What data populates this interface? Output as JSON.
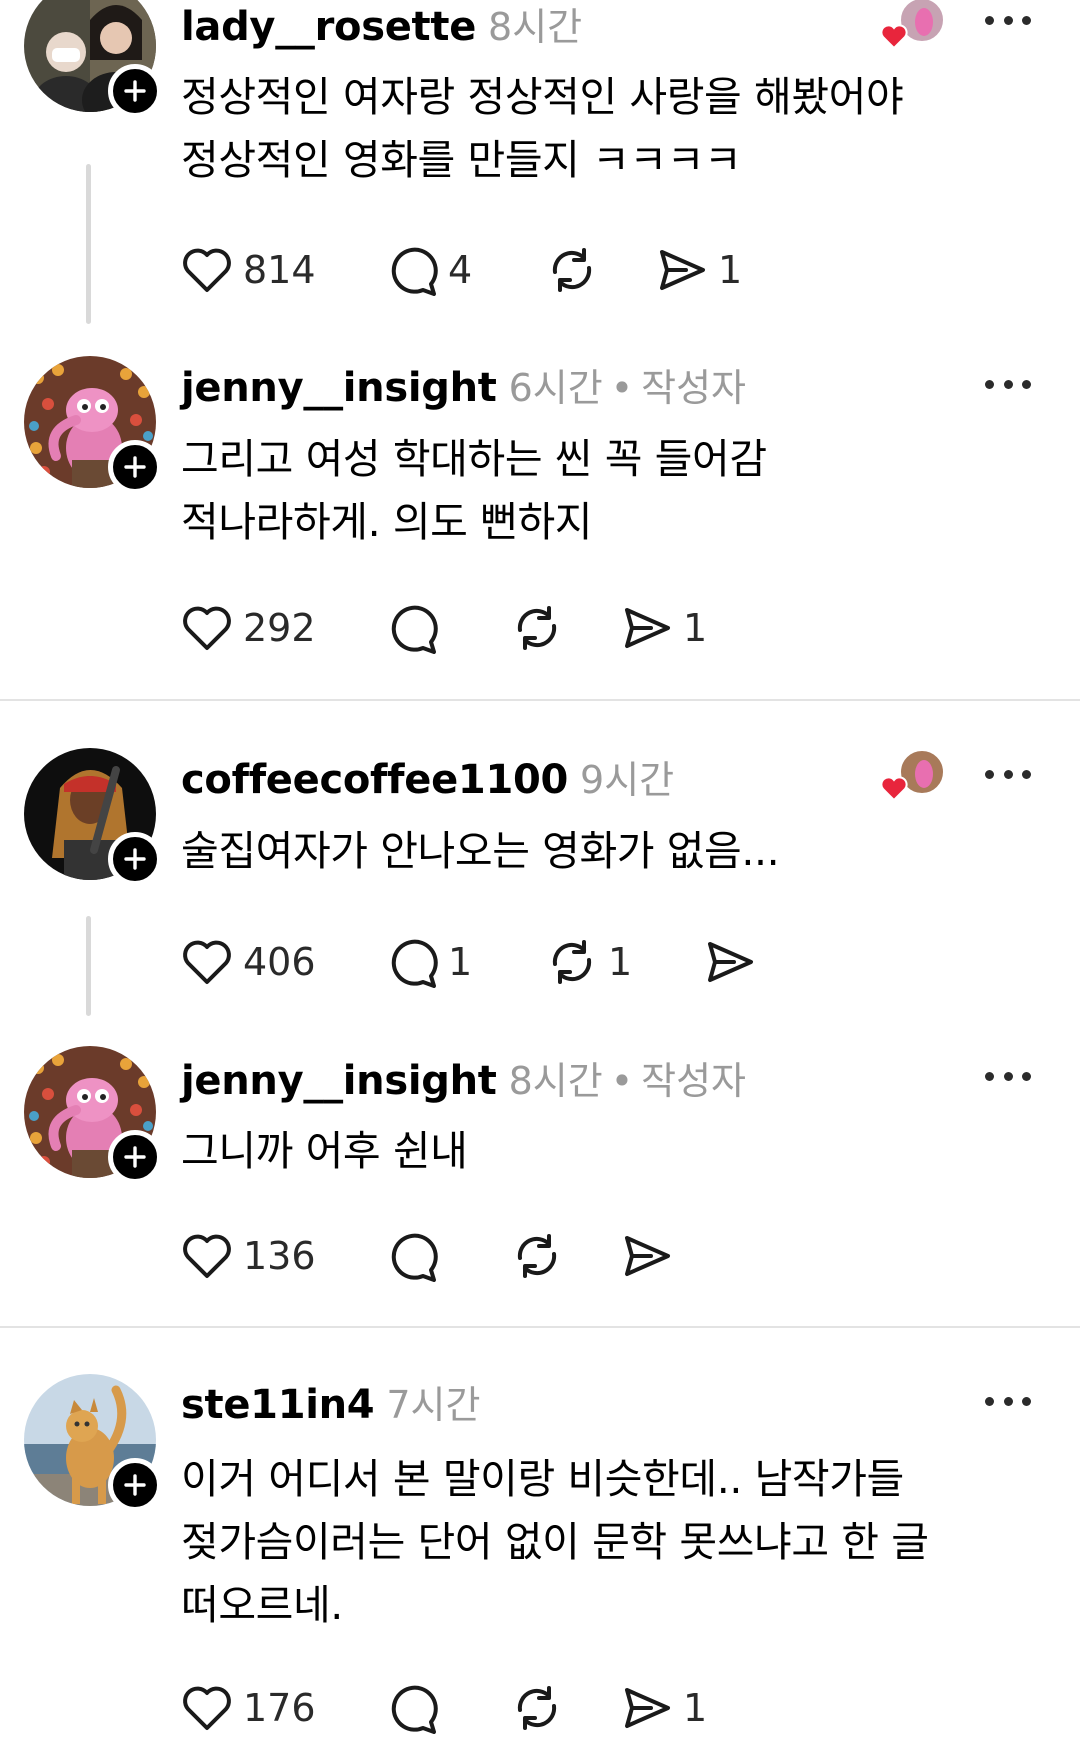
{
  "posts": [
    {
      "username": "lady__rosette",
      "time": "8시간",
      "author_tag": "",
      "text": "정상적인 여자랑 정상적인 사랑을 해봤어야\n정상적인 영화를 만들지 ㅋㅋㅋㅋ",
      "likes": "814",
      "replies": "4",
      "reposts": "",
      "shares": "1",
      "reacted_by_author": true
    },
    {
      "username": "jenny__insight",
      "time": "6시간",
      "author_tag": "작성자",
      "text": "그리고 여성 학대하는 씬 꼭 들어감\n적나라하게. 의도 뻔하지",
      "likes": "292",
      "replies": "",
      "reposts": "",
      "shares": "1",
      "reacted_by_author": false
    },
    {
      "username": "coffeecoffee1100",
      "time": "9시간",
      "author_tag": "",
      "text": "술집여자가 안나오는 영화가 없음...",
      "likes": "406",
      "replies": "1",
      "reposts": "1",
      "shares": "",
      "reacted_by_author": true
    },
    {
      "username": "jenny__insight",
      "time": "8시간",
      "author_tag": "작성자",
      "text": "그니까 어후 쉰내",
      "likes": "136",
      "replies": "",
      "reposts": "",
      "shares": "",
      "reacted_by_author": false
    },
    {
      "username": "ste11in4",
      "time": "7시간",
      "author_tag": "",
      "text": "이거 어디서 본 말이랑 비슷한데.. 남작가들\n젖가슴이러는 단어 없이 문학 못쓰냐고 한 글\n떠오르네.",
      "likes": "176",
      "replies": "",
      "reposts": "",
      "shares": "1",
      "reacted_by_author": false
    }
  ],
  "author_sep": "•",
  "icons": {
    "like": "heart-outline-icon",
    "reply": "speech-bubble-icon",
    "repost": "repost-arrows-icon",
    "share": "send-paper-plane-icon",
    "more": "more-horizontal-icon",
    "follow": "plus-icon",
    "reacted": "heart-filled-icon"
  },
  "colors": {
    "text": "#000000",
    "muted": "#9a9a9a",
    "heart_red": "#e8253c",
    "divider": "#e3e3e3"
  }
}
